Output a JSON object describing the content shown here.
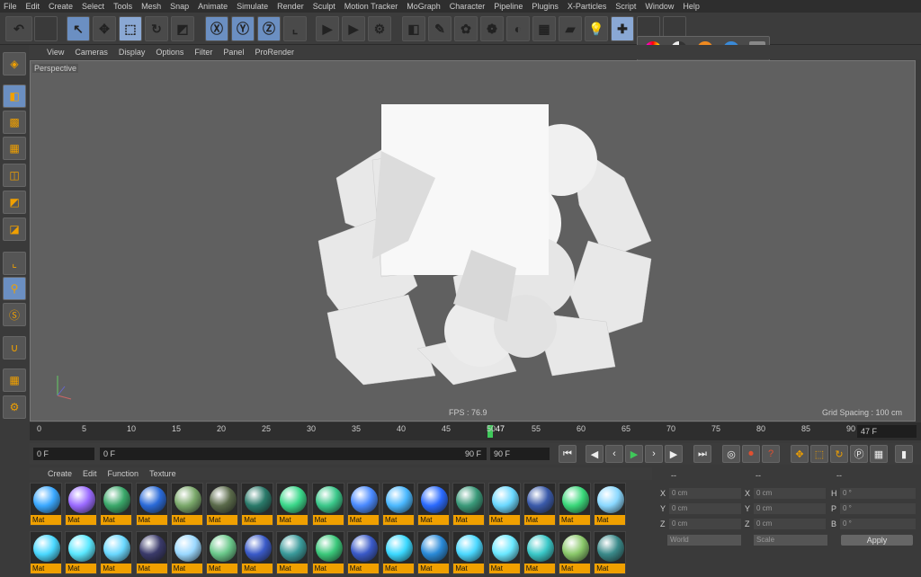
{
  "menu": [
    "File",
    "Edit",
    "Create",
    "Select",
    "Tools",
    "Mesh",
    "Snap",
    "Animate",
    "Simulate",
    "Render",
    "Sculpt",
    "Motion Tracker",
    "MoGraph",
    "Character",
    "Pipeline",
    "Plugins",
    "X-Particles",
    "Script",
    "Window",
    "Help"
  ],
  "viewport_menu": [
    "View",
    "Cameras",
    "Display",
    "Options",
    "Filter",
    "Panel",
    "ProRender"
  ],
  "viewport": {
    "label": "Perspective",
    "fps": "FPS : 76.9",
    "grid": "Grid Spacing : 100 cm"
  },
  "timeline": {
    "ticks": [
      "0",
      "5",
      "10",
      "15",
      "20",
      "25",
      "30",
      "35",
      "40",
      "45",
      "50",
      "55",
      "60",
      "65",
      "70",
      "75",
      "80",
      "85",
      "90"
    ],
    "current": "47",
    "end_frame": "47 F"
  },
  "transport": {
    "start": "0 F",
    "min": "0 F",
    "max": "90 F",
    "end": "90 F"
  },
  "material_menu": [
    "Create",
    "Edit",
    "Function",
    "Texture"
  ],
  "materials": {
    "label": "Mat",
    "colors": [
      "#3aa8ff",
      "#9a6aff",
      "#3aa86a",
      "#2a6ad8",
      "#7aa86a",
      "#5a6a4a",
      "#2a7a6a",
      "#3ad88a",
      "#3ac88a",
      "#4a8aff",
      "#4ab8ff",
      "#2a6aff",
      "#3a9a7a",
      "#6ad8ff",
      "#3a5aaa",
      "#3ad87a",
      "#8ad8ff",
      "#4ad8ff",
      "#5ae8ff",
      "#6ad8ff",
      "#3a3a6a",
      "#9ad8ff",
      "#6ac88a",
      "#3a5ac8",
      "#3a9a9a",
      "#3ac87a",
      "#3a5ac8",
      "#3ad8ff",
      "#2a8ad8",
      "#4ad8ff",
      "#6ae8ff",
      "#3ac8c8",
      "#8ac86a",
      "#3a8a8a"
    ]
  },
  "attributes": {
    "headers": [
      "--",
      "--",
      "--"
    ],
    "rows": [
      {
        "a": "X",
        "av": "0 cm",
        "b": "X",
        "bv": "0 cm",
        "c": "H",
        "cv": "0 °"
      },
      {
        "a": "Y",
        "av": "0 cm",
        "b": "Y",
        "bv": "0 cm",
        "c": "P",
        "cv": "0 °"
      },
      {
        "a": "Z",
        "av": "0 cm",
        "b": "Z",
        "bv": "0 cm",
        "c": "B",
        "cv": "0 °"
      }
    ],
    "coord_mode": "World",
    "scale_mode": "Scale",
    "apply": "Apply"
  },
  "accent": "#f0a000",
  "highlight": "#6b8fc2"
}
